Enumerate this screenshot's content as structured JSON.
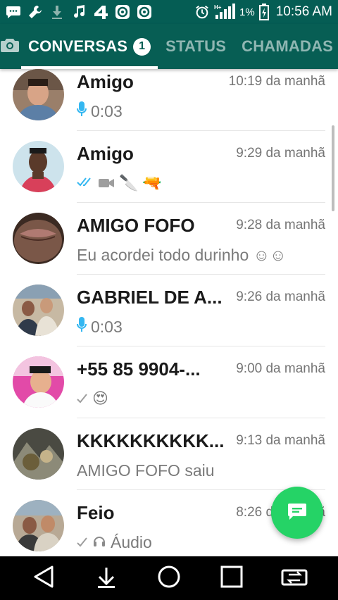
{
  "status_bar": {
    "battery_percent": "1%",
    "time": "10:56 AM",
    "signal_label": "H+",
    "icons": [
      "chat-bubble-icon",
      "wrench-icon",
      "download-icon",
      "music-note-icon",
      "app-4-icon",
      "app-circle-icon",
      "app-circle-icon",
      "alarm-icon",
      "signal-icon",
      "battery-icon"
    ]
  },
  "tabs": {
    "chats_label": "CONVERSAS",
    "chats_badge": "1",
    "status_label": "STATUS",
    "calls_label": "CHAMADAS",
    "active": "CONVERSAS"
  },
  "chats": [
    {
      "name": "Amigo",
      "time": "10:19 da manhã",
      "preview": "0:03",
      "preview_type": "voice"
    },
    {
      "name": "Amigo",
      "time": "9:29 da manhã",
      "preview": "",
      "preview_type": "video-emoji",
      "emojis": [
        "🔪",
        "🔫"
      ]
    },
    {
      "name": "AMIGO FOFO",
      "time": "9:28 da manhã",
      "preview": "Eu acordei todo durinho ☺☺",
      "preview_type": "text"
    },
    {
      "name": "GABRIEL DE A...",
      "time": "9:26 da manhã",
      "preview": "0:03",
      "preview_type": "voice"
    },
    {
      "name": "+55 85 9904-...",
      "time": "9:00 da manhã",
      "preview": "😍",
      "preview_type": "sent-emoji"
    },
    {
      "name": "KKKKKKKKKK...",
      "time": "9:13 da manhã",
      "preview": "AMIGO FOFO saiu",
      "preview_type": "text"
    },
    {
      "name": "Feio",
      "time": "8:26 da manhã",
      "preview": "Áudio",
      "preview_type": "sent-audio"
    }
  ],
  "colors": {
    "header": "#075e54",
    "status_bar": "#055d54",
    "fab": "#25d366",
    "accent_blue": "#34b7f1"
  }
}
